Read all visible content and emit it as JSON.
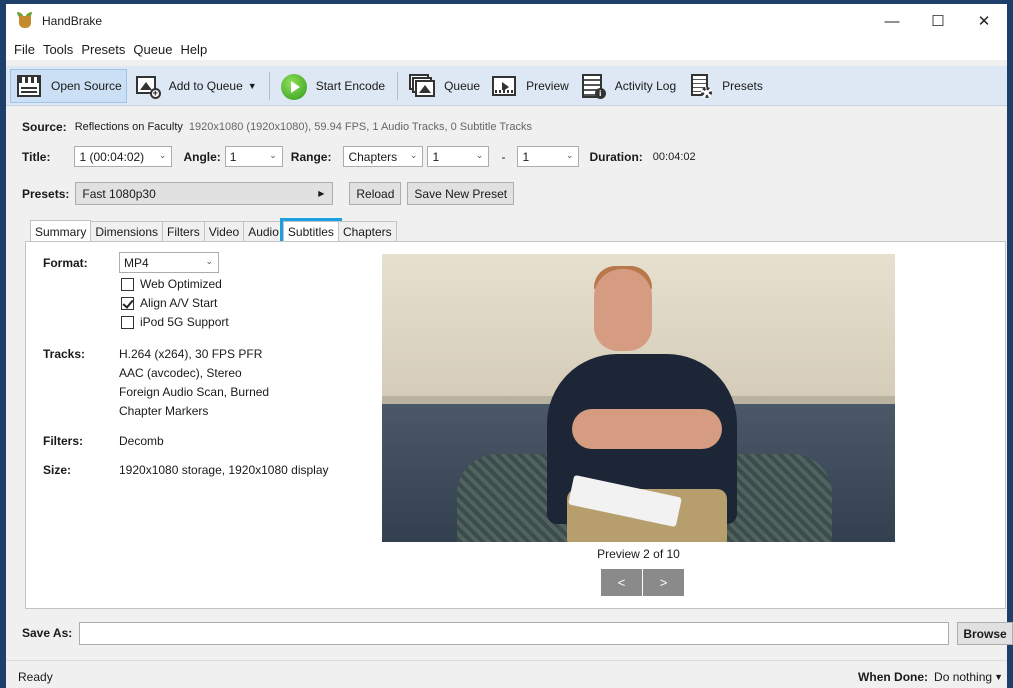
{
  "window": {
    "title": "HandBrake",
    "controls": {
      "minimize": "—",
      "maximize": "☐",
      "close": "✕"
    }
  },
  "menu": [
    "File",
    "Tools",
    "Presets",
    "Queue",
    "Help"
  ],
  "toolbar": {
    "open_source": "Open Source",
    "add_to_queue": "Add to Queue",
    "start_encode": "Start Encode",
    "queue": "Queue",
    "preview": "Preview",
    "activity_log": "Activity Log",
    "presets": "Presets"
  },
  "source": {
    "label": "Source:",
    "name": "Reflections on Faculty",
    "info": "1920x1080 (1920x1080), 59.94 FPS, 1 Audio Tracks, 0 Subtitle Tracks"
  },
  "title_row": {
    "title_label": "Title:",
    "title_value": "1 (00:04:02)",
    "angle_label": "Angle:",
    "angle_value": "1",
    "range_label": "Range:",
    "range_value": "Chapters",
    "range_start": "1",
    "range_dash": "-",
    "range_end": "1",
    "duration_label": "Duration:",
    "duration_value": "00:04:02"
  },
  "presets_row": {
    "label": "Presets:",
    "value": "Fast 1080p30",
    "reload": "Reload",
    "save_new": "Save New Preset"
  },
  "tabs": [
    "Summary",
    "Dimensions",
    "Filters",
    "Video",
    "Audio",
    "Subtitles",
    "Chapters"
  ],
  "summary": {
    "format_label": "Format:",
    "format_value": "MP4",
    "web_optimized": {
      "label": "Web Optimized",
      "checked": false
    },
    "align_av": {
      "label": "Align A/V Start",
      "checked": true
    },
    "ipod": {
      "label": "iPod 5G Support",
      "checked": false
    },
    "tracks_label": "Tracks:",
    "tracks": [
      "H.264 (x264), 30 FPS PFR",
      "AAC (avcodec), Stereo",
      "Foreign Audio Scan, Burned",
      "Chapter Markers"
    ],
    "filters_label": "Filters:",
    "filters_value": "Decomb",
    "size_label": "Size:",
    "size_value": "1920x1080 storage, 1920x1080 display"
  },
  "preview": {
    "caption": "Preview 2 of 10",
    "prev": "<",
    "next": ">"
  },
  "save_as": {
    "label": "Save As:",
    "value": "",
    "browse": "Browse"
  },
  "status": {
    "text": "Ready",
    "when_done_label": "When Done:",
    "when_done_value": "Do nothing"
  },
  "colors": {
    "toolbar_bg": "#dde8f4",
    "highlight_outline": "#1ba1e2",
    "window_border": "#1f3f6b"
  }
}
